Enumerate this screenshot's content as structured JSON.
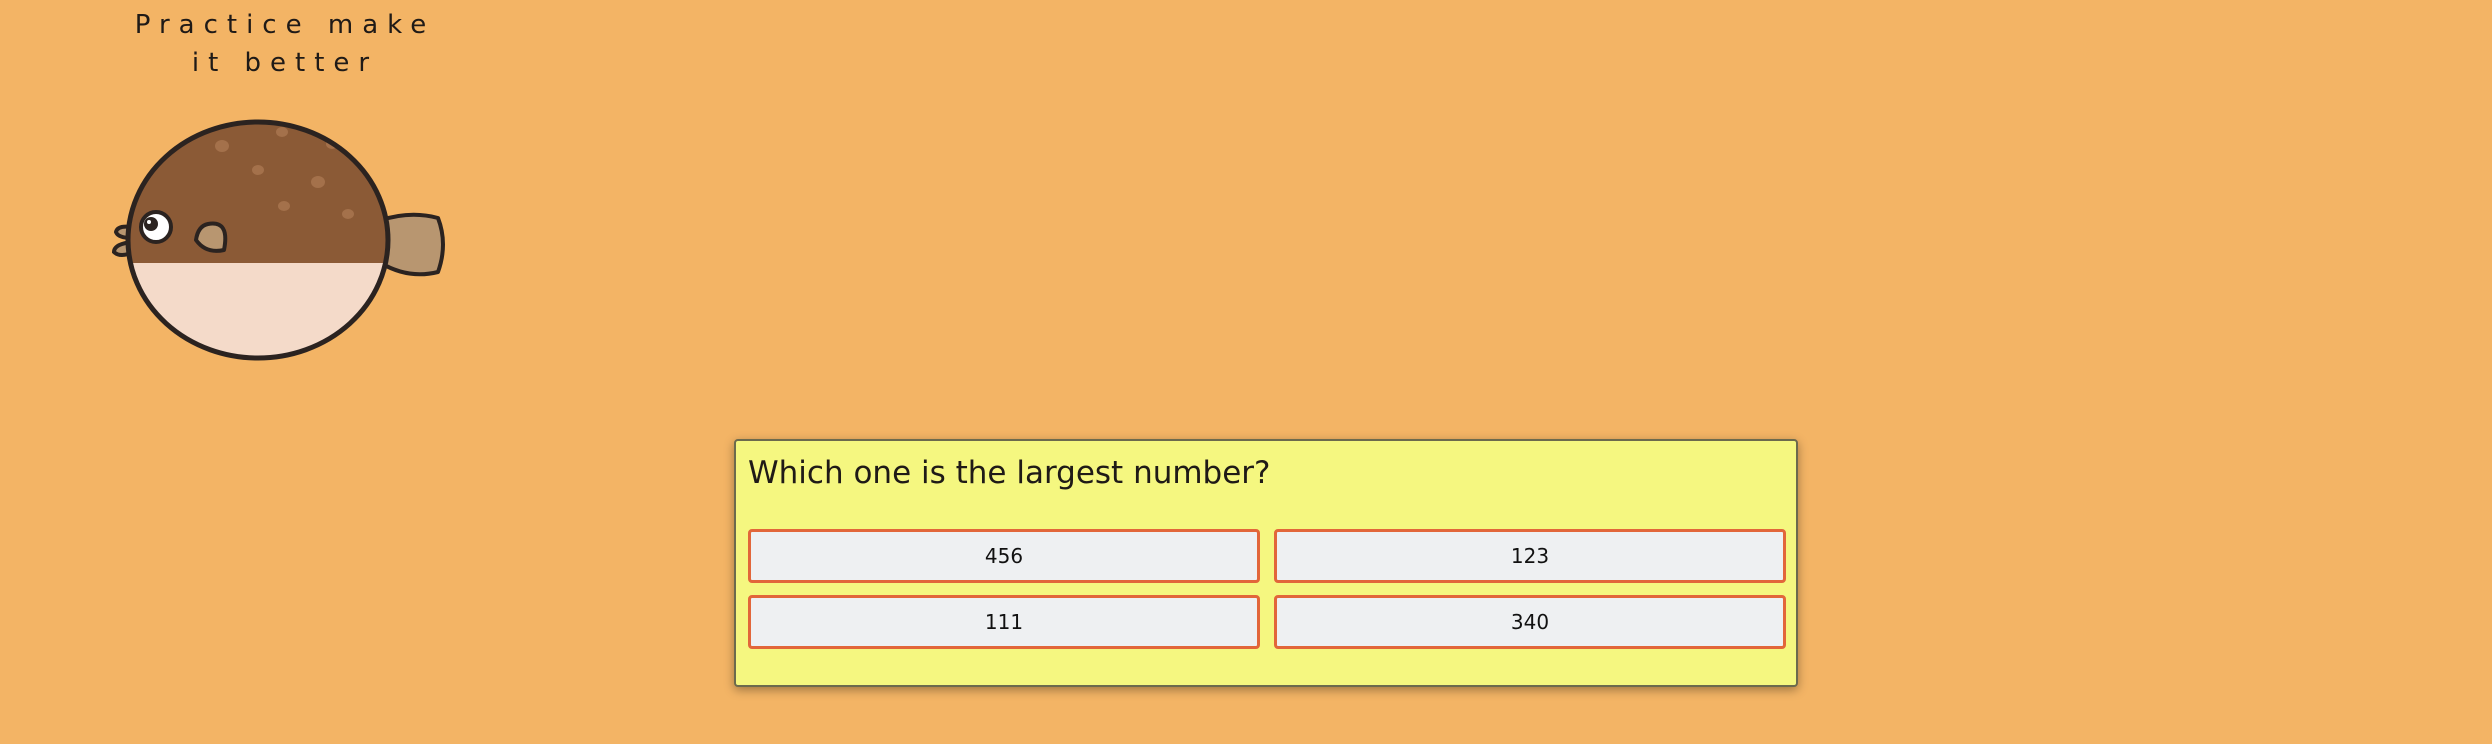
{
  "header": {
    "tagline_line1": "Practice make",
    "tagline_line2": "it better"
  },
  "mascot": {
    "icon": "pufferfish-icon"
  },
  "quiz": {
    "question": "Which one is the largest number?",
    "answers": [
      {
        "label": "456"
      },
      {
        "label": "123"
      },
      {
        "label": "111"
      },
      {
        "label": "340"
      }
    ]
  },
  "colors": {
    "background": "#f3b465",
    "card_background": "#f5f780",
    "answer_background": "#eef0f2",
    "answer_border": "#e2663a",
    "fish_body_top": "#8b5a36",
    "fish_body_bottom": "#f4dac9",
    "fish_fin": "#b89670",
    "outline": "#2b2320"
  }
}
